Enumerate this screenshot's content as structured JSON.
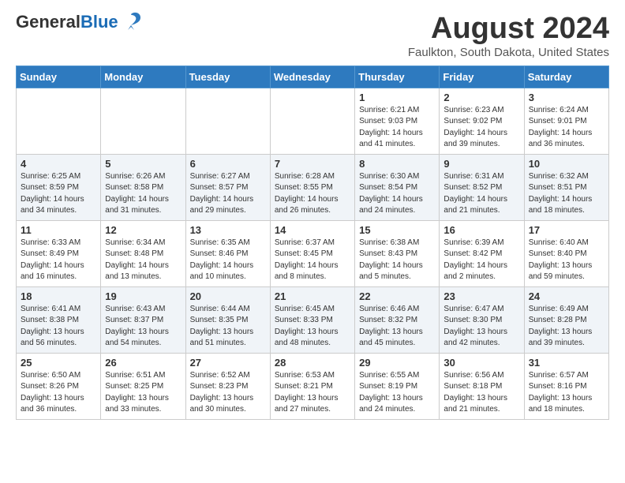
{
  "header": {
    "logo_general": "General",
    "logo_blue": "Blue",
    "month_title": "August 2024",
    "location": "Faulkton, South Dakota, United States"
  },
  "weekdays": [
    "Sunday",
    "Monday",
    "Tuesday",
    "Wednesday",
    "Thursday",
    "Friday",
    "Saturday"
  ],
  "weeks": [
    [
      {
        "day": "",
        "info": ""
      },
      {
        "day": "",
        "info": ""
      },
      {
        "day": "",
        "info": ""
      },
      {
        "day": "",
        "info": ""
      },
      {
        "day": "1",
        "info": "Sunrise: 6:21 AM\nSunset: 9:03 PM\nDaylight: 14 hours\nand 41 minutes."
      },
      {
        "day": "2",
        "info": "Sunrise: 6:23 AM\nSunset: 9:02 PM\nDaylight: 14 hours\nand 39 minutes."
      },
      {
        "day": "3",
        "info": "Sunrise: 6:24 AM\nSunset: 9:01 PM\nDaylight: 14 hours\nand 36 minutes."
      }
    ],
    [
      {
        "day": "4",
        "info": "Sunrise: 6:25 AM\nSunset: 8:59 PM\nDaylight: 14 hours\nand 34 minutes."
      },
      {
        "day": "5",
        "info": "Sunrise: 6:26 AM\nSunset: 8:58 PM\nDaylight: 14 hours\nand 31 minutes."
      },
      {
        "day": "6",
        "info": "Sunrise: 6:27 AM\nSunset: 8:57 PM\nDaylight: 14 hours\nand 29 minutes."
      },
      {
        "day": "7",
        "info": "Sunrise: 6:28 AM\nSunset: 8:55 PM\nDaylight: 14 hours\nand 26 minutes."
      },
      {
        "day": "8",
        "info": "Sunrise: 6:30 AM\nSunset: 8:54 PM\nDaylight: 14 hours\nand 24 minutes."
      },
      {
        "day": "9",
        "info": "Sunrise: 6:31 AM\nSunset: 8:52 PM\nDaylight: 14 hours\nand 21 minutes."
      },
      {
        "day": "10",
        "info": "Sunrise: 6:32 AM\nSunset: 8:51 PM\nDaylight: 14 hours\nand 18 minutes."
      }
    ],
    [
      {
        "day": "11",
        "info": "Sunrise: 6:33 AM\nSunset: 8:49 PM\nDaylight: 14 hours\nand 16 minutes."
      },
      {
        "day": "12",
        "info": "Sunrise: 6:34 AM\nSunset: 8:48 PM\nDaylight: 14 hours\nand 13 minutes."
      },
      {
        "day": "13",
        "info": "Sunrise: 6:35 AM\nSunset: 8:46 PM\nDaylight: 14 hours\nand 10 minutes."
      },
      {
        "day": "14",
        "info": "Sunrise: 6:37 AM\nSunset: 8:45 PM\nDaylight: 14 hours\nand 8 minutes."
      },
      {
        "day": "15",
        "info": "Sunrise: 6:38 AM\nSunset: 8:43 PM\nDaylight: 14 hours\nand 5 minutes."
      },
      {
        "day": "16",
        "info": "Sunrise: 6:39 AM\nSunset: 8:42 PM\nDaylight: 14 hours\nand 2 minutes."
      },
      {
        "day": "17",
        "info": "Sunrise: 6:40 AM\nSunset: 8:40 PM\nDaylight: 13 hours\nand 59 minutes."
      }
    ],
    [
      {
        "day": "18",
        "info": "Sunrise: 6:41 AM\nSunset: 8:38 PM\nDaylight: 13 hours\nand 56 minutes."
      },
      {
        "day": "19",
        "info": "Sunrise: 6:43 AM\nSunset: 8:37 PM\nDaylight: 13 hours\nand 54 minutes."
      },
      {
        "day": "20",
        "info": "Sunrise: 6:44 AM\nSunset: 8:35 PM\nDaylight: 13 hours\nand 51 minutes."
      },
      {
        "day": "21",
        "info": "Sunrise: 6:45 AM\nSunset: 8:33 PM\nDaylight: 13 hours\nand 48 minutes."
      },
      {
        "day": "22",
        "info": "Sunrise: 6:46 AM\nSunset: 8:32 PM\nDaylight: 13 hours\nand 45 minutes."
      },
      {
        "day": "23",
        "info": "Sunrise: 6:47 AM\nSunset: 8:30 PM\nDaylight: 13 hours\nand 42 minutes."
      },
      {
        "day": "24",
        "info": "Sunrise: 6:49 AM\nSunset: 8:28 PM\nDaylight: 13 hours\nand 39 minutes."
      }
    ],
    [
      {
        "day": "25",
        "info": "Sunrise: 6:50 AM\nSunset: 8:26 PM\nDaylight: 13 hours\nand 36 minutes."
      },
      {
        "day": "26",
        "info": "Sunrise: 6:51 AM\nSunset: 8:25 PM\nDaylight: 13 hours\nand 33 minutes."
      },
      {
        "day": "27",
        "info": "Sunrise: 6:52 AM\nSunset: 8:23 PM\nDaylight: 13 hours\nand 30 minutes."
      },
      {
        "day": "28",
        "info": "Sunrise: 6:53 AM\nSunset: 8:21 PM\nDaylight: 13 hours\nand 27 minutes."
      },
      {
        "day": "29",
        "info": "Sunrise: 6:55 AM\nSunset: 8:19 PM\nDaylight: 13 hours\nand 24 minutes."
      },
      {
        "day": "30",
        "info": "Sunrise: 6:56 AM\nSunset: 8:18 PM\nDaylight: 13 hours\nand 21 minutes."
      },
      {
        "day": "31",
        "info": "Sunrise: 6:57 AM\nSunset: 8:16 PM\nDaylight: 13 hours\nand 18 minutes."
      }
    ]
  ]
}
